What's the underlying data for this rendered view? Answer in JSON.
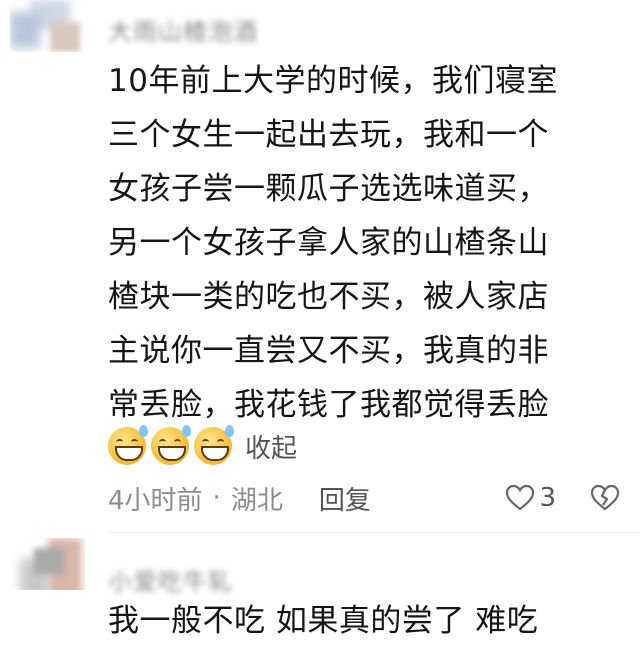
{
  "comments": [
    {
      "username": "大雨山楂泡酒",
      "lines": [
        "10年前上大学的时候，我们寝室",
        "三个女生一起出去玩，我和一个",
        "女孩子尝一颗瓜子选选味道买，",
        "另一个女孩子拿人家的山楂条山",
        "楂块一类的吃也不买，被人家店",
        "主说你一直尝又不买，我真的非",
        "常丢脸，我花钱了我都觉得丢脸"
      ],
      "emojis": [
        "grin-sweat-emoji",
        "grin-sweat-emoji",
        "grin-sweat-emoji"
      ],
      "collapse_label": "收起",
      "time": "4小时前",
      "separator": "·",
      "location": "湖北",
      "reply_label": "回复",
      "like_count": "3"
    },
    {
      "username": "小爱吃牛轧",
      "lines": [
        "我一般不吃  如果真的尝了 难吃"
      ]
    }
  ]
}
